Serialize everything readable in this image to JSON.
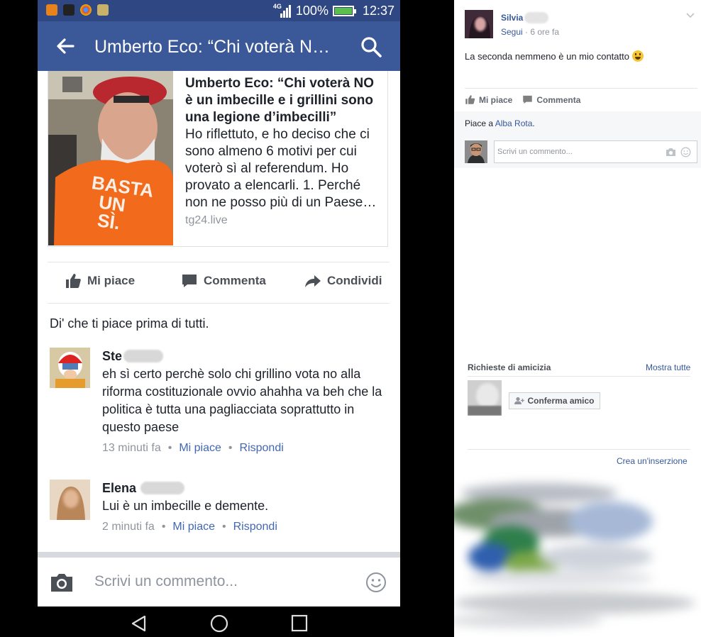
{
  "colors": {
    "fb_blue": "#3b5998",
    "status_bar": "#2f4782",
    "link": "#4267b2",
    "desktop_link": "#365899"
  },
  "status_bar": {
    "network": "4G",
    "battery": "100%",
    "time": "12:37",
    "app_icons": [
      "notification-app-icon",
      "terminal-app-icon",
      "chrome-app-icon",
      "gallery-app-icon"
    ]
  },
  "app_bar": {
    "title": "Umberto Eco: “Chi voterà N…",
    "back_icon": "back-arrow-icon",
    "search_icon": "search-icon"
  },
  "link_card": {
    "title": "Umberto Eco: “Chi voterà NO è un imbecille e i grillini sono una legione d’imbecilli”",
    "description": "Ho riflettuto, e ho deciso che ci sono almeno 6 motivi per cui voterò sì al referendum. Ho provato a elencarli. 1. Perché non ne posso più di un Paese…",
    "domain": "tg24.live",
    "image_text": [
      "BASTA",
      "UN",
      "SÌ."
    ]
  },
  "actions": {
    "like": "Mi piace",
    "comment": "Commenta",
    "share": "Condividi"
  },
  "first_like_prompt": "Di' che ti piace prima di tutti.",
  "comments": [
    {
      "name": "Ste",
      "text": "eh sì certo perchè solo chi  grillino vota no alla riforma costituzionale ovvio ahahha va beh che la politica è tutta una pagliacciata soprattutto in questo paese",
      "time": "13 minuti fa",
      "like": "Mi piace",
      "reply": "Rispondi"
    },
    {
      "name": "Elena",
      "text": "Lui è un imbecille e demente.",
      "time": "2 minuti fa",
      "like": "Mi piace",
      "reply": "Rispondi"
    }
  ],
  "compose": {
    "placeholder": "Scrivi un commento..."
  },
  "desktop": {
    "post": {
      "author": "Silvia",
      "follow": "Segui",
      "time": "6 ore fa",
      "text": "La seconda nemmeno è un mio contatto"
    },
    "actions": {
      "like": "Mi piace",
      "comment": "Commenta"
    },
    "likes": {
      "prefix": "Piace a",
      "who": "Alba Rota",
      "suffix": "."
    },
    "comment_placeholder": "Scrivi un commento...",
    "friend_requests": {
      "title": "Richieste di amicizia",
      "show_all": "Mostra tutte",
      "confirm": "Conferma amico"
    },
    "ads": {
      "create": "Crea un'inserzione"
    }
  }
}
